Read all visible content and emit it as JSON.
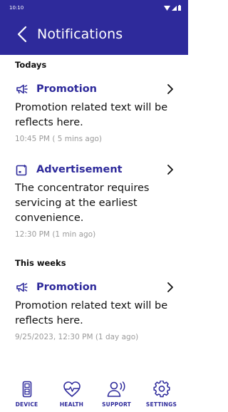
{
  "status_bar": {
    "time": "10:10"
  },
  "header": {
    "title": "Notifications",
    "back_icon": "chevron-left-icon"
  },
  "colors": {
    "primary": "#2e2a9b",
    "text": "#111111",
    "muted": "#9a9a9a"
  },
  "sections": [
    {
      "label": "Todays",
      "items": [
        {
          "icon": "megaphone-icon",
          "title": "Promotion",
          "text": "Promotion related text will be reflects here.",
          "time": "10:45 PM ( 5 mins ago)"
        },
        {
          "icon": "advertisement-icon",
          "title": "Advertisement",
          "text": "The concentrator requires servicing at the earliest convenience.",
          "time": "12:30 PM (1 min ago)"
        }
      ]
    },
    {
      "label": "This weeks",
      "items": [
        {
          "icon": "megaphone-icon",
          "title": "Promotion",
          "text": "Promotion related text will be reflects here.",
          "time": "9/25/2023, 12:30 PM (1 day ago)"
        }
      ]
    }
  ],
  "bottom_nav": [
    {
      "label": "DEVICE",
      "icon": "device-icon"
    },
    {
      "label": "HEALTH",
      "icon": "health-heart-icon"
    },
    {
      "label": "SUPPORT",
      "icon": "support-icon"
    },
    {
      "label": "SETTINGS",
      "icon": "gear-icon"
    }
  ]
}
